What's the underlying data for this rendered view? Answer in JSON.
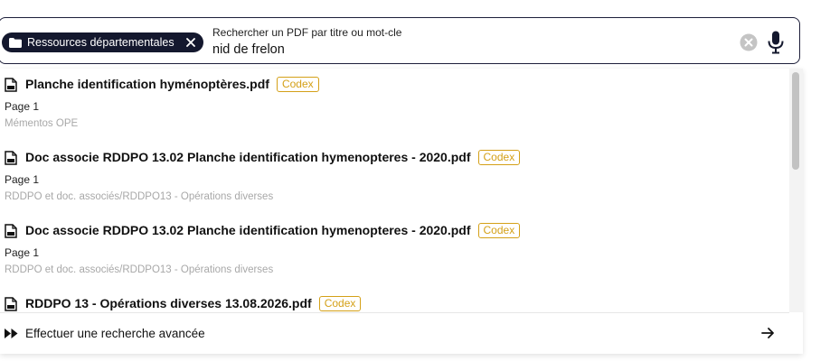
{
  "search": {
    "scope_chip": "Ressources départementales",
    "field_label": "Rechercher un PDF par titre ou mot-cle",
    "query": "nid de frelon"
  },
  "results": [
    {
      "title": "Planche identification hyménoptères.pdf",
      "badge": "Codex",
      "page": "Page 1",
      "path": "Mémentos OPE"
    },
    {
      "title": "Doc associe RDDPO 13.02 Planche identification hymenopteres - 2020.pdf",
      "badge": "Codex",
      "page": "Page 1",
      "path": "RDDPO et doc. associés/RDDPO13 - Opérations diverses"
    },
    {
      "title": "Doc associe RDDPO 13.02 Planche identification hymenopteres - 2020.pdf",
      "badge": "Codex",
      "page": "Page 1",
      "path": "RDDPO et doc. associés/RDDPO13 - Opérations diverses"
    },
    {
      "title": "RDDPO 13 - Opérations diverses 13.08.2026.pdf",
      "badge": "Codex",
      "page": "",
      "path": ""
    }
  ],
  "advanced_search": {
    "label": "Effectuer une recherche avancée"
  },
  "colors": {
    "chip_bg": "#14182e",
    "badge": "#d4a017",
    "border": "#1d1f3a"
  },
  "icons": [
    "folder-icon",
    "close-icon",
    "clear-icon",
    "microphone-icon",
    "pdf-file-icon",
    "fast-forward-icon",
    "arrow-right-icon"
  ]
}
